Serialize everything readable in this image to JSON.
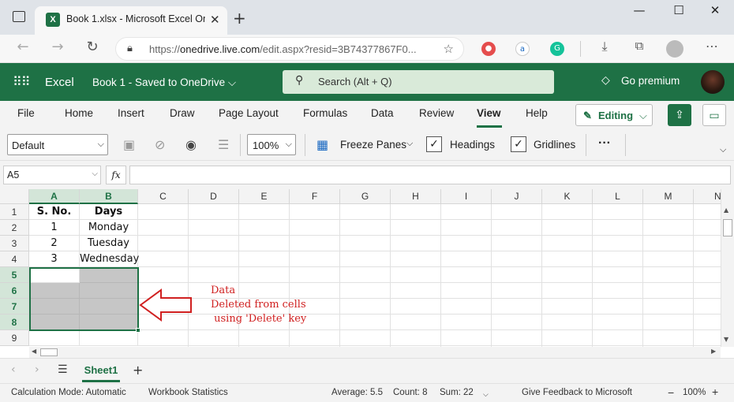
{
  "browser": {
    "tab_title": "Book 1.xlsx - Microsoft Excel Onl",
    "tab_icon": "X",
    "url_domain": "onedrive.live.com",
    "url_prefix": "https://",
    "url_rest": "/edit.aspx?resid=3B74377867F0..."
  },
  "excel": {
    "app_name": "Excel",
    "book_name": "Book 1  -  Saved to OneDrive ⌵",
    "search_placeholder": "Search (Alt + Q)",
    "premium": "Go premium",
    "brand_color": "#1e7145"
  },
  "ribbon": {
    "tabs": [
      "File",
      "Home",
      "Insert",
      "Draw",
      "Page Layout",
      "Formulas",
      "Data",
      "Review",
      "View",
      "Help"
    ],
    "active_tab": "View",
    "editing_label": "Editing"
  },
  "toolbar": {
    "style_value": "Default",
    "zoom_value": "100%",
    "freeze_panes": "Freeze Panes",
    "headings": "Headings",
    "gridlines": "Gridlines",
    "more": "···"
  },
  "formula_bar": {
    "name_box": "A5",
    "fx": "fx",
    "formula": ""
  },
  "grid": {
    "columns": [
      "A",
      "B",
      "C",
      "D",
      "E",
      "F",
      "G",
      "H",
      "I",
      "J",
      "K",
      "L",
      "M",
      "N"
    ],
    "rows": [
      "1",
      "2",
      "3",
      "4",
      "5",
      "6",
      "7",
      "8",
      "9"
    ],
    "cells": {
      "A1": "S. No.",
      "B1": "Days",
      "A2": "1",
      "B2": "Monday",
      "A3": "2",
      "B3": "Tuesday",
      "A4": "3",
      "B4": "Wednesday"
    }
  },
  "annotation": {
    "line1": "Data",
    "line2": "Deleted from cells",
    "line3": " using 'Delete' key",
    "color": "#d02020"
  },
  "sheets": {
    "active": "Sheet1",
    "add": "+",
    "menu": "☰"
  },
  "status": {
    "calc_mode": "Calculation Mode: Automatic",
    "workbook_stats": "Workbook Statistics",
    "average": "Average: 5.5",
    "count": "Count: 8",
    "sum": "Sum: 22",
    "feedback": "Give Feedback to Microsoft",
    "zoom": "100%"
  }
}
